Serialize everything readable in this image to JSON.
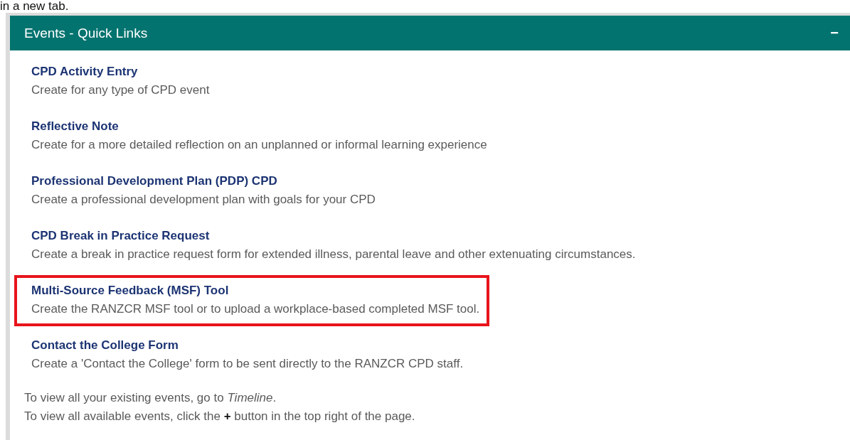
{
  "intro_text": "in a new tab.",
  "panel": {
    "title": "Events - Quick Links",
    "collapse_button": "−",
    "links": [
      {
        "title": "CPD Activity Entry",
        "description": "Create for any type of CPD event",
        "highlighted": false
      },
      {
        "title": "Reflective Note",
        "description": "Create for a more detailed reflection on an unplanned or informal learning experience",
        "highlighted": false
      },
      {
        "title": "Professional Development Plan (PDP) CPD",
        "description": "Create a professional development plan with goals for your CPD",
        "highlighted": false
      },
      {
        "title": "CPD Break in Practice Request",
        "description": "Create a break in practice request form for extended illness, parental leave and other extenuating circumstances.",
        "highlighted": false
      },
      {
        "title": "Multi-Source Feedback (MSF) Tool",
        "description": "Create the RANZCR MSF tool or to upload a workplace-based completed MSF tool.",
        "highlighted": true
      },
      {
        "title": "Contact the College Form",
        "description": "Create a 'Contact the College' form to be sent directly to the RANZCR CPD staff.",
        "highlighted": false
      }
    ],
    "notes": [
      "To view all your existing events, go to *Timeline*.",
      "To view all available events, click the **+** button in the top right of the page."
    ]
  }
}
